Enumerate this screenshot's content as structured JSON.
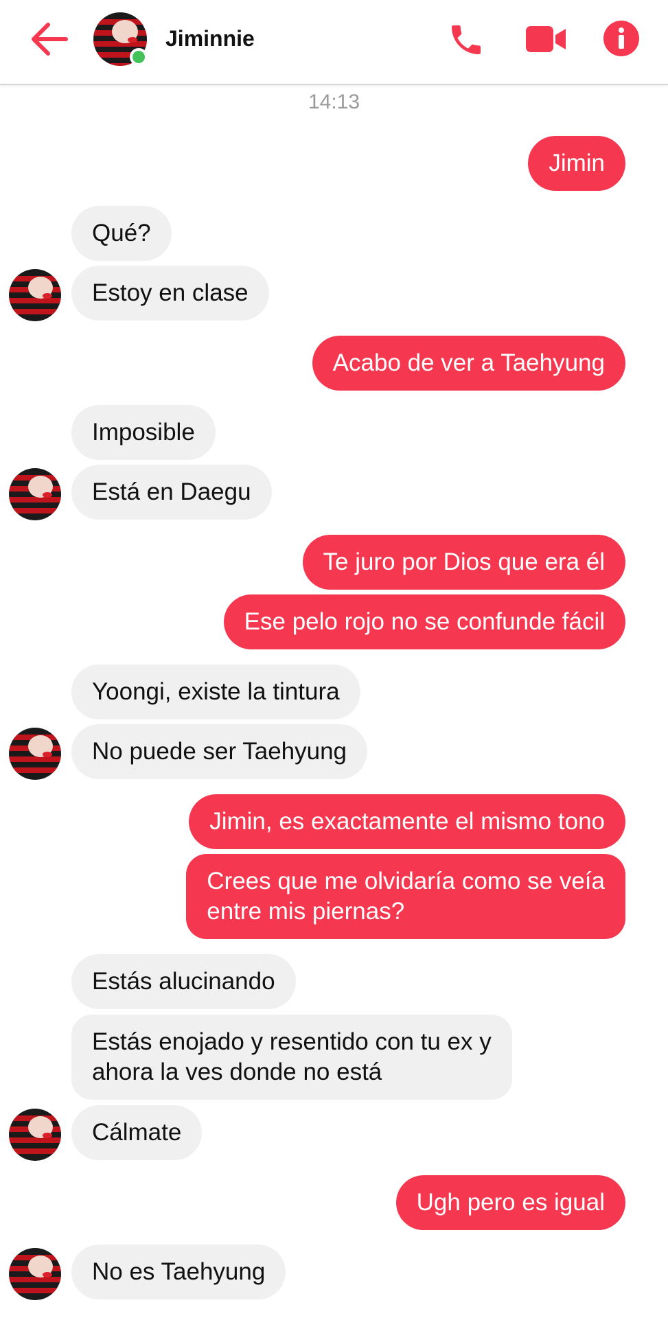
{
  "header": {
    "contact_name": "Jiminnie",
    "icons": [
      "back-arrow-icon",
      "phone-icon",
      "video-camera-icon",
      "info-icon"
    ],
    "online": true
  },
  "conversation": {
    "timestamp": "14:13",
    "messages": [
      {
        "from": "me",
        "text": "Jimin"
      },
      {
        "from": "them",
        "text": "Qué?"
      },
      {
        "from": "them",
        "text": "Estoy en clase"
      },
      {
        "from": "me",
        "text": "Acabo de ver a Taehyung"
      },
      {
        "from": "them",
        "text": "Imposible"
      },
      {
        "from": "them",
        "text": "Está en Daegu"
      },
      {
        "from": "me",
        "text": "Te juro por Dios que era él"
      },
      {
        "from": "me",
        "text": "Ese pelo rojo no se confunde fácil"
      },
      {
        "from": "them",
        "text": "Yoongi, existe la tintura"
      },
      {
        "from": "them",
        "text": "No puede ser Taehyung"
      },
      {
        "from": "me",
        "text": "Jimin, es exactamente el mismo tono"
      },
      {
        "from": "me",
        "text": "Crees que me olvidaría como se veía\nentre mis piernas?"
      },
      {
        "from": "them",
        "text": "Estás alucinando"
      },
      {
        "from": "them",
        "text": "Estás enojado y resentido con tu ex y\nahora la ves donde no está"
      },
      {
        "from": "them",
        "text": "Cálmate"
      },
      {
        "from": "me",
        "text": "Ugh pero es igual"
      },
      {
        "from": "them",
        "text": "No es Taehyung"
      }
    ]
  },
  "colors": {
    "accent": "#f5374f",
    "incoming_bubble": "#f0f0f0",
    "online": "#43c25a"
  }
}
